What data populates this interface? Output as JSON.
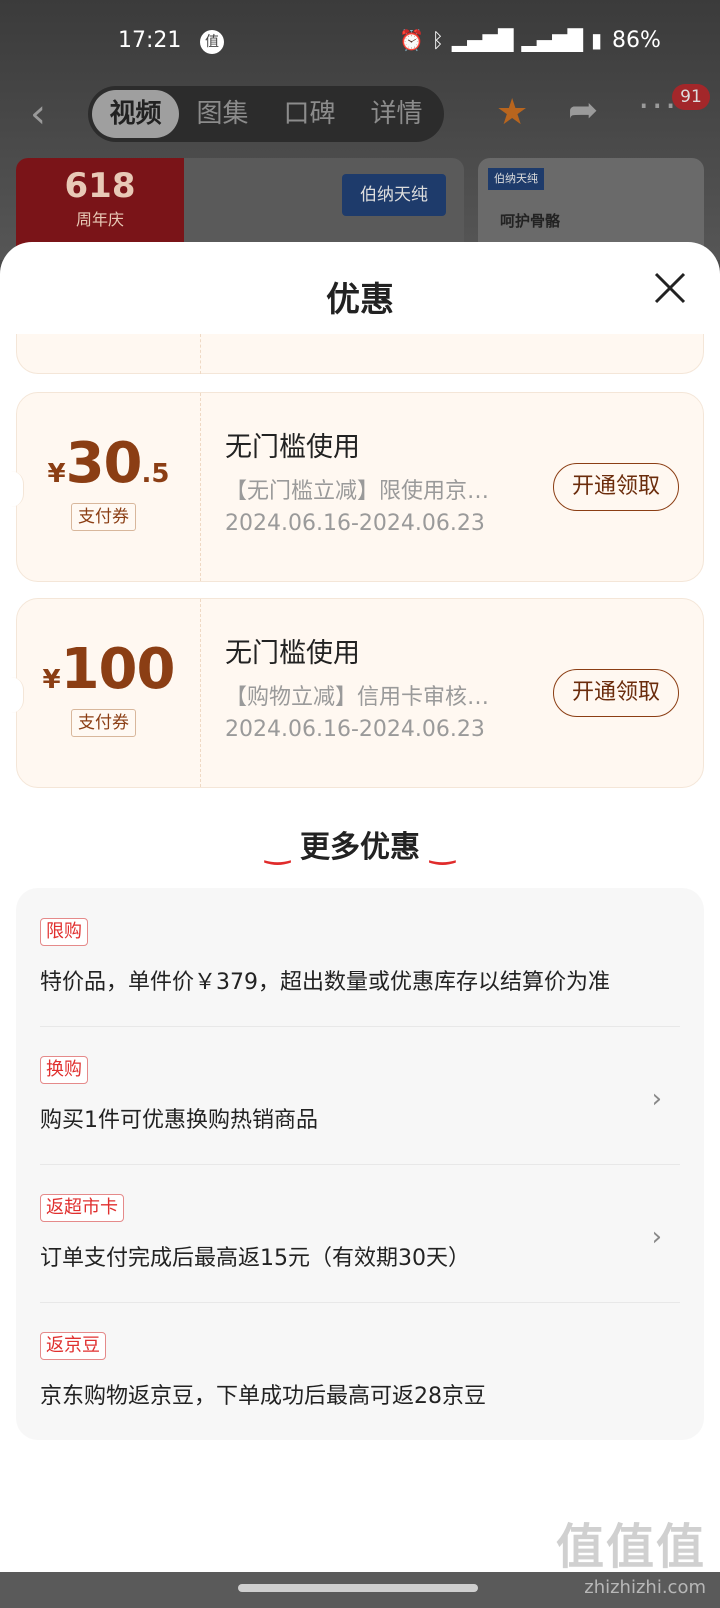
{
  "status_bar": {
    "time": "17:21",
    "app_icon_glyph": "值",
    "battery": "86%"
  },
  "nav": {
    "tabs": [
      "视频",
      "图集",
      "口碑",
      "详情"
    ],
    "active_tab": 0,
    "badge": "91"
  },
  "banners": {
    "a_red_big": "618",
    "a_red_small": "周年庆",
    "a_logo": "伯纳天纯",
    "b_logo": "伯纳天纯",
    "b_text": "呵护骨骼"
  },
  "sheet": {
    "title": "优惠",
    "coupons": [
      {
        "yen": "¥",
        "amount": "30",
        "decimal": ".5",
        "tag": "支付券",
        "title": "无门槛使用",
        "desc": "【无门槛立减】限使用京…",
        "date": "2024.06.16-2024.06.23",
        "button": "开通领取"
      },
      {
        "yen": "¥",
        "amount": "100",
        "decimal": "",
        "tag": "支付券",
        "title": "无门槛使用",
        "desc": "【购物立减】信用卡审核…",
        "date": "2024.06.16-2024.06.23",
        "button": "开通领取"
      }
    ],
    "more_heading": "更多优惠",
    "promos": [
      {
        "tag": "限购",
        "text": "特价品，单件价￥379，超出数量或优惠库存以结算价为准",
        "has_arrow": false
      },
      {
        "tag": "换购",
        "text": "购买1件可优惠换购热销商品",
        "has_arrow": true
      },
      {
        "tag": "返超市卡",
        "text": "订单支付完成后最高返15元（有效期30天）",
        "has_arrow": true
      },
      {
        "tag": "返京豆",
        "text": "京东购物返京豆，下单成功后最高可返28京豆",
        "has_arrow": false
      }
    ]
  },
  "watermark": {
    "big": "值值值",
    "url": "zhizhizhi.com"
  },
  "colors": {
    "accent_brown": "#8b3e14",
    "tag_red": "#e0302f",
    "coupon_bg": "#fff8f1"
  }
}
